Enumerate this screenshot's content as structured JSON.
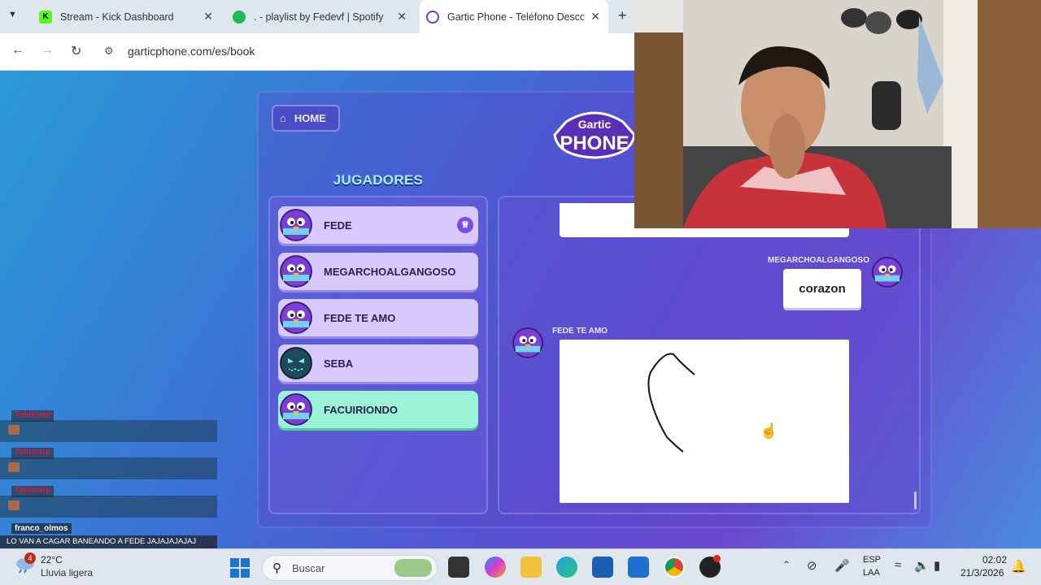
{
  "browser": {
    "tabs": [
      {
        "title": "Stream - Kick Dashboard",
        "icon": "kick-icon",
        "active": false
      },
      {
        "title": ". - playlist by Fedevf | Spotify",
        "icon": "spotify-icon",
        "active": false
      },
      {
        "title": "Gartic Phone - Teléfono Descon",
        "icon": "gartic-icon",
        "active": true
      }
    ],
    "url": "garticphone.com/es/book"
  },
  "game": {
    "home_label": "HOME",
    "logo_top": "Gartic",
    "logo_bottom": "PHONE",
    "players_title": "JUGADORES",
    "players": [
      {
        "name": "FEDE",
        "host": true,
        "avatar": "purple-bird"
      },
      {
        "name": "MEGARCHOALGANGOSO",
        "host": false,
        "avatar": "purple-bird"
      },
      {
        "name": "FEDE TE AMO",
        "host": false,
        "avatar": "purple-bird"
      },
      {
        "name": "SEBA",
        "host": false,
        "avatar": "dark-monster"
      },
      {
        "name": "FACUIRIONDO",
        "host": false,
        "avatar": "purple-bird",
        "active": true
      }
    ],
    "album": [
      {
        "author": "MEGARCHOALGANGOSO",
        "text": "corazon"
      },
      {
        "author": "FEDE TE AMO",
        "type": "drawing"
      }
    ]
  },
  "stream_chat": [
    {
      "user": "Tobiicarp"
    },
    {
      "user": "Tobiicarp"
    },
    {
      "user": "Tobiicarp"
    },
    {
      "user": "franco_olmos",
      "message": "LO VAN A CAGAR BANEANDO A FEDE JAJAJAJAJAJ"
    }
  ],
  "taskbar": {
    "weather_badge": "4",
    "temperature": "22°C",
    "condition": "Lluvia ligera",
    "search_placeholder": "Buscar",
    "lang_line1": "ESP",
    "lang_line2": "LAA",
    "time": "02:02",
    "date": "21/3/2026"
  },
  "colors": {
    "player_bg": "#d7c9fb",
    "player_active_bg": "#9af3d6",
    "title_color": "#9ef0ff",
    "chat_user_color": "#d8194a"
  }
}
